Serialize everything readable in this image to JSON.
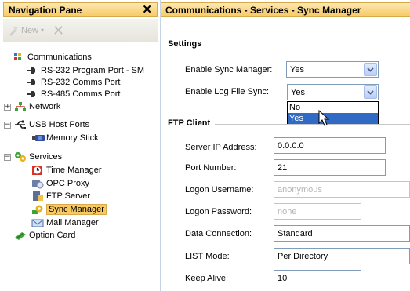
{
  "nav": {
    "title": "Navigation Pane",
    "new_label": "New"
  },
  "tree": [
    {
      "label": "Communications"
    },
    {
      "label": "RS-232 Program Port - SM"
    },
    {
      "label": "RS-232 Comms Port"
    },
    {
      "label": "RS-485 Comms Port"
    },
    {
      "label": "Network"
    },
    {
      "label": "USB Host Ports"
    },
    {
      "label": "Memory Stick"
    },
    {
      "label": "Services"
    },
    {
      "label": "Time Manager"
    },
    {
      "label": "OPC Proxy"
    },
    {
      "label": "FTP Server"
    },
    {
      "label": "Sync Manager"
    },
    {
      "label": "Mail Manager"
    },
    {
      "label": "Option Card"
    }
  ],
  "main": {
    "title": "Communications - Services - Sync Manager",
    "settings": {
      "title": "Settings",
      "enable_sync_label": "Enable Sync Manager:",
      "enable_sync_value": "Yes",
      "enable_log_label": "Enable Log File Sync:",
      "enable_log_value": "Yes",
      "dropdown_options": [
        "No",
        "Yes"
      ]
    },
    "ftp": {
      "title": "FTP Client",
      "server_ip_label": "Server IP Address:",
      "server_ip_value": "0.0.0.0",
      "port_label": "Port Number:",
      "port_value": "21",
      "username_label": "Logon Username:",
      "username_value": "anonymous",
      "password_label": "Logon Password:",
      "password_value": "none",
      "data_conn_label": "Data Connection:",
      "data_conn_value": "Standard",
      "list_mode_label": "LIST Mode:",
      "list_mode_value": "Per Directory",
      "keep_alive_label": "Keep Alive:",
      "keep_alive_value": "10"
    }
  },
  "colors": {
    "header_gradient_top": "#fde8b2",
    "header_gradient_bottom": "#f7c963",
    "selection_blue": "#316ac5"
  }
}
